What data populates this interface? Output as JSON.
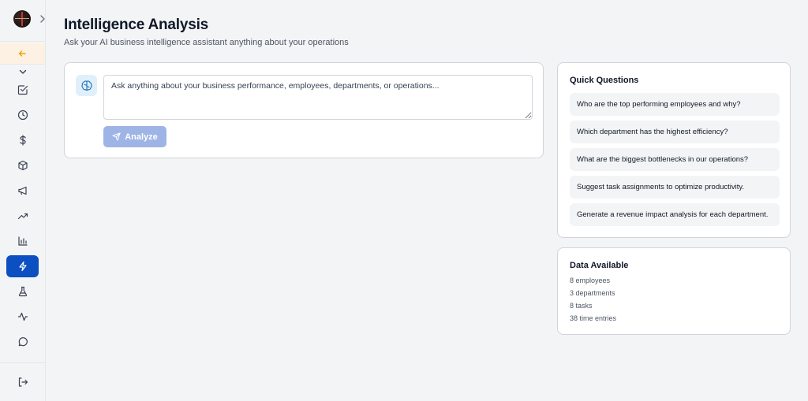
{
  "sidebar": {
    "items": [
      {
        "icon": "chevron-down-icon"
      },
      {
        "icon": "check-square-icon"
      },
      {
        "icon": "clock-icon"
      },
      {
        "icon": "dollar-icon"
      },
      {
        "icon": "package-icon"
      },
      {
        "icon": "megaphone-icon"
      },
      {
        "icon": "trending-up-icon"
      },
      {
        "icon": "bar-chart-icon"
      },
      {
        "icon": "lightning-icon",
        "active": true
      },
      {
        "icon": "flask-icon"
      },
      {
        "icon": "activity-icon"
      },
      {
        "icon": "message-circle-icon"
      }
    ],
    "accent_color": "#0b4fc1"
  },
  "header": {
    "title": "Intelligence Analysis",
    "subtitle": "Ask your AI business intelligence assistant anything about your operations"
  },
  "query": {
    "placeholder": "Ask anything about your business performance, employees, departments, or operations...",
    "value": "",
    "analyze_label": "Analyze"
  },
  "quick_questions": {
    "title": "Quick Questions",
    "items": [
      "Who are the top performing employees and why?",
      "Which department has the highest efficiency?",
      "What are the biggest bottlenecks in our operations?",
      "Suggest task assignments to optimize productivity.",
      "Generate a revenue impact analysis for each department."
    ]
  },
  "data_available": {
    "title": "Data Available",
    "lines": [
      "8 employees",
      "3 departments",
      "8 tasks",
      "38 time entries"
    ]
  }
}
